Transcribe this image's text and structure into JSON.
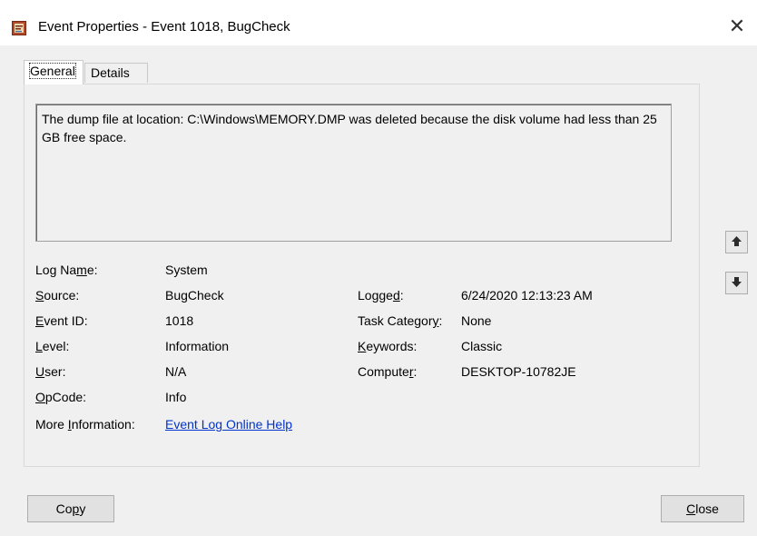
{
  "window": {
    "title": "Event Properties - Event 1018, BugCheck",
    "close_glyph": "✕"
  },
  "tabs": [
    {
      "label": "General",
      "active": true
    },
    {
      "label": "Details",
      "active": false
    }
  ],
  "description": "The dump file at location: C:\\Windows\\MEMORY.DMP was deleted because the disk volume had less than 25 GB free space.",
  "fields": {
    "log_name": {
      "label_pre": "Log Na",
      "label_u": "m",
      "label_post": "e:",
      "value": "System"
    },
    "source": {
      "label_pre": "",
      "label_u": "S",
      "label_post": "ource:",
      "value": "BugCheck"
    },
    "event_id": {
      "label_pre": "",
      "label_u": "E",
      "label_post": "vent ID:",
      "value": "1018"
    },
    "level": {
      "label_pre": "",
      "label_u": "L",
      "label_post": "evel:",
      "value": "Information"
    },
    "user": {
      "label_pre": "",
      "label_u": "U",
      "label_post": "ser:",
      "value": "N/A"
    },
    "opcode": {
      "label_pre": "",
      "label_u": "O",
      "label_post": "pCode:",
      "value": "Info"
    },
    "more_info": {
      "label_pre": "More ",
      "label_u": "I",
      "label_post": "nformation:",
      "value": "Event Log Online Help"
    },
    "logged": {
      "label_pre": "Logge",
      "label_u": "d",
      "label_post": ":",
      "value": "6/24/2020 12:13:23 AM"
    },
    "task_category": {
      "label_pre": "Task Categor",
      "label_u": "y",
      "label_post": ":",
      "value": "None"
    },
    "keywords": {
      "label_pre": "",
      "label_u": "K",
      "label_post": "eywords:",
      "value": "Classic"
    },
    "computer": {
      "label_pre": "Compute",
      "label_u": "r",
      "label_post": ":",
      "value": "DESKTOP-10782JE"
    }
  },
  "buttons": {
    "copy": {
      "pre": "Co",
      "u": "p",
      "post": "y"
    },
    "close": {
      "pre": "",
      "u": "C",
      "post": "lose"
    }
  },
  "icons": {
    "up": "arrow-up-icon",
    "down": "arrow-down-icon"
  }
}
